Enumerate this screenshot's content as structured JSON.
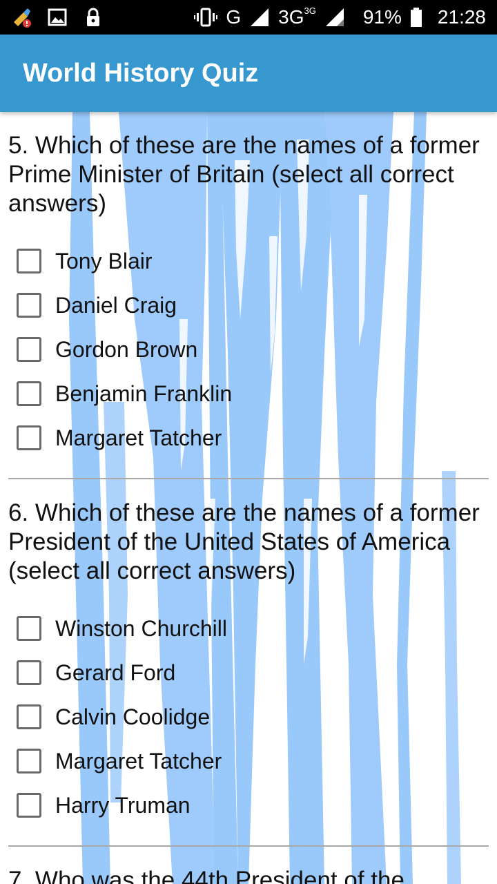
{
  "status_bar": {
    "network_g": "G",
    "network_3g": "3G",
    "network_3g_sup": "3G",
    "battery": "91%",
    "time": "21:28",
    "icons": [
      "cleaner-icon",
      "image-icon",
      "lock-icon",
      "vibrate-icon",
      "signal-icon",
      "battery-icon"
    ]
  },
  "app_bar": {
    "title": "World History Quiz",
    "color": "#3797cf"
  },
  "questions": [
    {
      "text": "5. Which of these are the names of a former Prime Minister of Britain (select all correct answers)",
      "options": [
        "Tony Blair",
        "Daniel Craig",
        "Gordon Brown",
        "Benjamin Franklin",
        "Margaret Tatcher"
      ]
    },
    {
      "text": "6. Which of these are the names of a former President of the United States of America (select all correct answers)",
      "options": [
        "Winston Churchill",
        "Gerard Ford",
        "Calvin Coolidge",
        "Margaret Tatcher",
        "Harry Truman"
      ]
    },
    {
      "text": "7. Who was the 44th President of the"
    }
  ]
}
